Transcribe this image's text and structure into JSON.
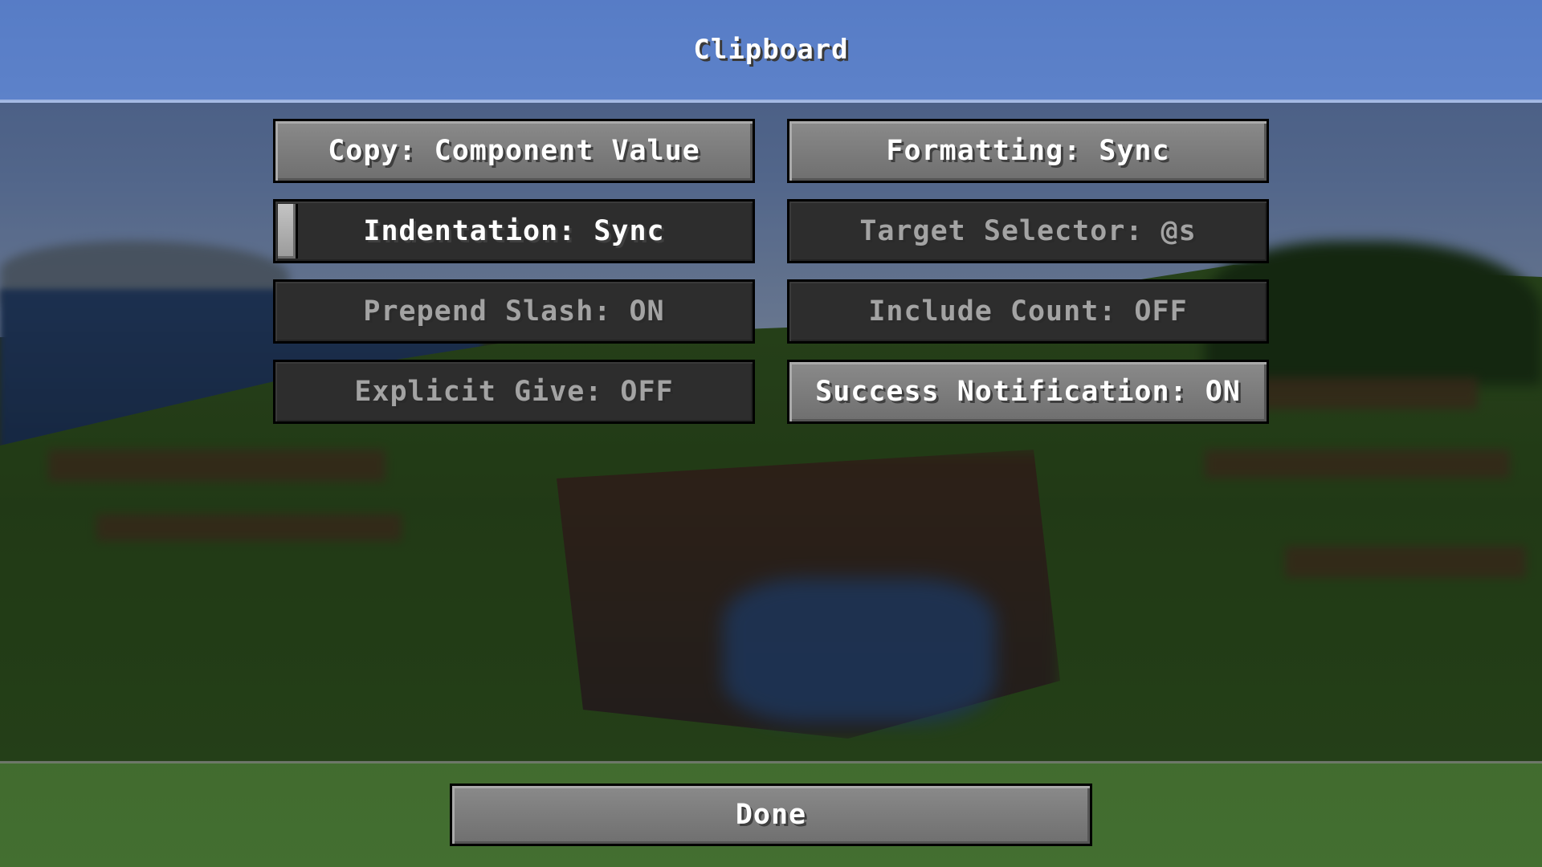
{
  "screen": {
    "title": "Clipboard"
  },
  "options": {
    "copy_label": "Copy: Component Value",
    "formatting_label": "Formatting: Sync",
    "indentation_label": "Indentation: Sync",
    "indentation_slider_value": 0.0,
    "target_selector_label": "Target Selector: @s",
    "prepend_slash_label": "Prepend Slash: ON",
    "include_count_label": "Include Count: OFF",
    "explicit_give_label": "Explicit Give: OFF",
    "success_notification_label": "Success Notification: ON"
  },
  "footer": {
    "done_label": "Done"
  },
  "colors": {
    "active_button": "#7c7c7c",
    "inactive_button": "#2d2d2d",
    "enabled_text": "#ffffff",
    "disabled_text": "#a3a3a3",
    "header": "#5f86c9"
  }
}
